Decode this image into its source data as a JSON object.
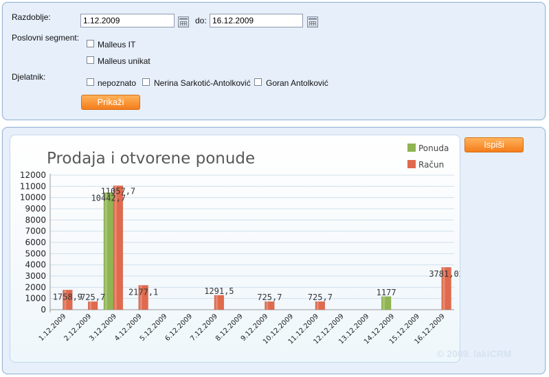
{
  "filters": {
    "period_label": "Razdoblje:",
    "date_from": "1.12.2009",
    "to_label": "do:",
    "date_to": "16.12.2009",
    "segment_label": "Poslovni segment:",
    "segments": [
      {
        "label": "Malleus IT",
        "checked": false
      },
      {
        "label": "Malleus unikat",
        "checked": false
      }
    ],
    "employee_label": "Djelatnik:",
    "employees": [
      {
        "label": "nepoznato",
        "checked": false
      },
      {
        "label": "Nerina Sarkotić-Antolković",
        "checked": false
      },
      {
        "label": "Goran Antolković",
        "checked": false
      }
    ],
    "show_button": "Prikaži"
  },
  "print_button": "Ispiši",
  "watermark": "© 2009. lakiCRM",
  "chart_data": {
    "type": "bar",
    "title": "Prodaja i otvorene ponude",
    "categories": [
      "1.12.2009",
      "2.12.2009",
      "3.12.2009",
      "4.12.2009",
      "5.12.2009",
      "6.12.2009",
      "7.12.2009",
      "8.12.2009",
      "9.12.2009",
      "10.12.2009",
      "11.12.2009",
      "12.12.2009",
      "13.12.2009",
      "14.12.2009",
      "15.12.2009",
      "16.12.2009"
    ],
    "series": [
      {
        "name": "Ponuda",
        "color": "#8fb553",
        "values": [
          0,
          0,
          10442.7,
          0,
          0,
          0,
          0,
          0,
          0,
          0,
          0,
          0,
          0,
          1177,
          0,
          0
        ]
      },
      {
        "name": "Račun",
        "color": "#e06a4d",
        "values": [
          1758.9,
          725.7,
          11057.7,
          2177.1,
          0,
          0,
          1291.5,
          0,
          725.7,
          0,
          725.7,
          0,
          0,
          0,
          0,
          3781.02
        ]
      }
    ],
    "data_labels": [
      {
        "series": "Račun",
        "category": "1.12.2009",
        "text": "1758,9"
      },
      {
        "series": "Račun",
        "category": "2.12.2009",
        "text": "725,7"
      },
      {
        "series": "Ponuda",
        "category": "3.12.2009",
        "text": "10442,7"
      },
      {
        "series": "Račun",
        "category": "3.12.2009",
        "text": "11057,7"
      },
      {
        "series": "Račun",
        "category": "4.12.2009",
        "text": "2177,1"
      },
      {
        "series": "Račun",
        "category": "7.12.2009",
        "text": "1291,5"
      },
      {
        "series": "Račun",
        "category": "9.12.2009",
        "text": "725,7"
      },
      {
        "series": "Račun",
        "category": "11.12.2009",
        "text": "725,7"
      },
      {
        "series": "Ponuda",
        "category": "14.12.2009",
        "text": "1177"
      },
      {
        "series": "Račun",
        "category": "16.12.2009",
        "text": "3781,02"
      }
    ],
    "ylim": [
      0,
      12000
    ],
    "yticks": [
      0,
      1000,
      2000,
      3000,
      4000,
      5000,
      6000,
      7000,
      8000,
      9000,
      10000,
      11000,
      12000
    ],
    "grid": true,
    "legend_position": "top-right"
  }
}
